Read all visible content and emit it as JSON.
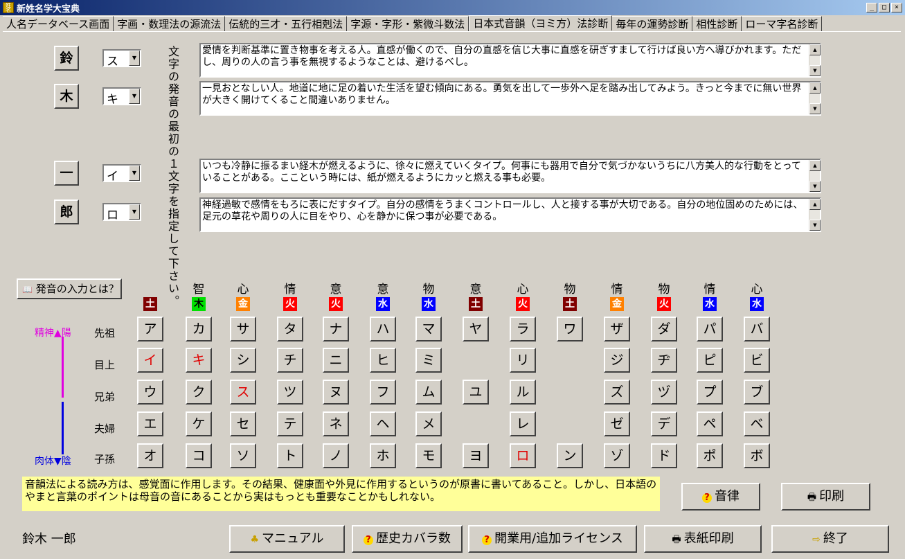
{
  "window": {
    "app_icon_text": "姓名宝典",
    "title": "新姓名学大宝典",
    "min_glyph": "_",
    "max_glyph": "□",
    "close_glyph": "×"
  },
  "tabs": [
    {
      "label": "人名データベース画面"
    },
    {
      "label": "字画・数理法の源流法"
    },
    {
      "label": "伝統的三才・五行相剋法"
    },
    {
      "label": "字源・字形・紫微斗数法"
    },
    {
      "label": "日本式音韻（ヨミ方）法診断"
    },
    {
      "label": "毎年の運勢診断"
    },
    {
      "label": "相性診断"
    },
    {
      "label": "ローマ字名診断"
    }
  ],
  "active_tab_index": 4,
  "name_chars": [
    {
      "kanji": "鈴",
      "reading": "ス",
      "text": "愛情を判断基準に置き物事を考える人。直感が働くので、自分の直感を信じ大事に直感を研ぎすまして行けば良い方へ導びかれます。ただし、周りの人の言う事を無視するようなことは、避けるべし。"
    },
    {
      "kanji": "木",
      "reading": "キ",
      "text": "一見おとなしい人。地道に地に足の着いた生活を望む傾向にある。勇気を出して一歩外へ足を踏み出してみよう。きっと今までに無い世界が大きく開けてくること間違いありません。"
    },
    {
      "kanji": "一",
      "reading": "イ",
      "text": "いつも冷静に振るまい経木が燃えるように、徐々に燃えていくタイプ。何事にも器用で自分で気づかないうちに八方美人的な行動をとっていることがある。ここという時には、紙が燃えるようにカッと燃える事も必要。"
    },
    {
      "kanji": "郎",
      "reading": "ロ",
      "text": "神経過敏で感情をもろに表にだすタイプ。自分の感情をうまくコントロールし、人と接する事が大切である。自分の地位固めのためには、足元の草花や周りの人に目をやり、心を静かに保つ事が必要である。"
    }
  ],
  "vertical_instruction": "文字の発音の最初の１文字を指定して下さい。",
  "help_button": {
    "icon": "help-book-icon",
    "label": "発音の入力とは？"
  },
  "table": {
    "columns": [
      {
        "top": "",
        "elem": "土",
        "elem_class": "earth"
      },
      {
        "top": "智",
        "elem": "木",
        "elem_class": "wood"
      },
      {
        "top": "心",
        "elem": "金",
        "elem_class": "metal"
      },
      {
        "top": "情",
        "elem": "火",
        "elem_class": "fire"
      },
      {
        "top": "意",
        "elem": "火",
        "elem_class": "fire"
      },
      {
        "top": "意",
        "elem": "水",
        "elem_class": "water"
      },
      {
        "top": "物",
        "elem": "水",
        "elem_class": "water"
      },
      {
        "top": "意",
        "elem": "土",
        "elem_class": "earth"
      },
      {
        "top": "心",
        "elem": "火",
        "elem_class": "fire"
      },
      {
        "top": "物",
        "elem": "土",
        "elem_class": "earth"
      },
      {
        "top": "情",
        "elem": "金",
        "elem_class": "metal"
      },
      {
        "top": "物",
        "elem": "火",
        "elem_class": "fire"
      },
      {
        "top": "情",
        "elem": "水",
        "elem_class": "water"
      },
      {
        "top": "心",
        "elem": "水",
        "elem_class": "water"
      }
    ],
    "rows": [
      "先祖",
      "目上",
      "兄弟",
      "夫婦",
      "子孫"
    ],
    "kana": [
      [
        "ア",
        "イ",
        "ウ",
        "エ",
        "オ"
      ],
      [
        "カ",
        "キ",
        "ク",
        "ケ",
        "コ"
      ],
      [
        "サ",
        "シ",
        "ス",
        "セ",
        "ソ"
      ],
      [
        "タ",
        "チ",
        "ツ",
        "テ",
        "ト"
      ],
      [
        "ナ",
        "ニ",
        "ヌ",
        "ネ",
        "ノ"
      ],
      [
        "ハ",
        "ヒ",
        "フ",
        "ヘ",
        "ホ"
      ],
      [
        "マ",
        "ミ",
        "ム",
        "メ",
        "モ"
      ],
      [
        "ヤ",
        "",
        "ユ",
        "",
        "ヨ"
      ],
      [
        "ラ",
        "リ",
        "ル",
        "レ",
        "ロ"
      ],
      [
        "ワ",
        "",
        "",
        "",
        "ン"
      ],
      [
        "ザ",
        "ジ",
        "ズ",
        "ゼ",
        "ゾ"
      ],
      [
        "ダ",
        "ヂ",
        "ヅ",
        "デ",
        "ド"
      ],
      [
        "パ",
        "ピ",
        "プ",
        "ペ",
        "ポ"
      ],
      [
        "バ",
        "ビ",
        "ブ",
        "ベ",
        "ボ"
      ]
    ],
    "highlighted": [
      "イ",
      "キ",
      "ス",
      "ロ"
    ],
    "highlight_color": "#e00000"
  },
  "axis": {
    "top_left": "精神",
    "top_right": "陽",
    "bottom_left": "肉体",
    "bottom_right": "陰",
    "up_color": "#e000e0",
    "down_color": "#0000e0"
  },
  "note": "音韻法による読み方は、感覚面に作用します。その結果、健康面や外見に作用するというのが原書に書いてあること。しかし、日本語のやまと言葉のポイントは母音の音にあることから実はもっとも重要なことかもしれない。",
  "buttons": {
    "onritsu": "音律",
    "print": "印刷",
    "manual": "マニュアル",
    "history": "歴史カバラ数",
    "license": "開業用/追加ライセンス",
    "cover_print": "表紙印刷",
    "exit": "終了"
  },
  "status_name": "鈴木  一郎"
}
